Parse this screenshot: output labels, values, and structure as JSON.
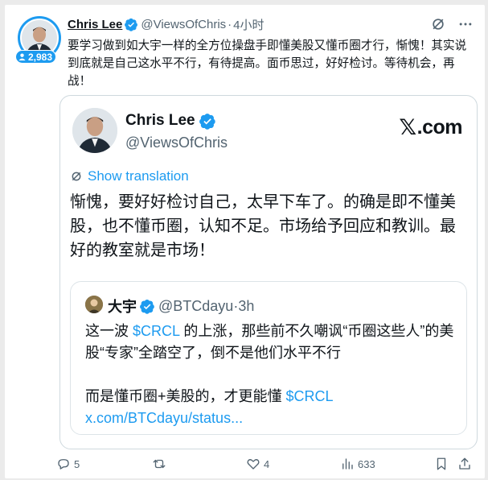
{
  "post": {
    "author_name": "Chris Lee",
    "author_handle": "@ViewsOfChris",
    "separator": "·",
    "time": "4小时",
    "followers_badge": "2,983",
    "text": "要学习做到如大宇一样的全方位操盘手即懂美股又懂币圈才行，惭愧！其实说到底就是自己这水平不行，有待提高。面币思过，好好检讨。等待机会，再战！"
  },
  "card": {
    "name": "Chris Lee",
    "handle": "@ViewsOfChris",
    "brand_mark": "𝕏",
    "brand_text": ".com",
    "show_translation": "Show translation",
    "text": "惭愧，要好好检讨自己，太早下车了。的确是即不懂美股，也不懂币圈，认知不足。市场给予回应和教训。最好的教室就是市场！"
  },
  "inner": {
    "name": "大宇",
    "handle": "@BTCdayu",
    "separator": "·",
    "time": "3h",
    "line1_a": "这一波 ",
    "line1_link": "$CRCL",
    "line1_b": " 的上涨，那些前不久嘲讽“币圈这些人”的美股“专家”全踏空了，倒不是他们水平不行",
    "line2_a": "而是懂币圈+美股的，才更能懂 ",
    "line2_link": "$CRCL x.com/BTCdayu/status..."
  },
  "actions": {
    "replies": "5",
    "reposts": "",
    "likes": "4",
    "views": "633"
  },
  "colors": {
    "accent": "#1d9bf0",
    "text": "#0f1419",
    "muted": "#536471",
    "border": "#cfd9de"
  }
}
